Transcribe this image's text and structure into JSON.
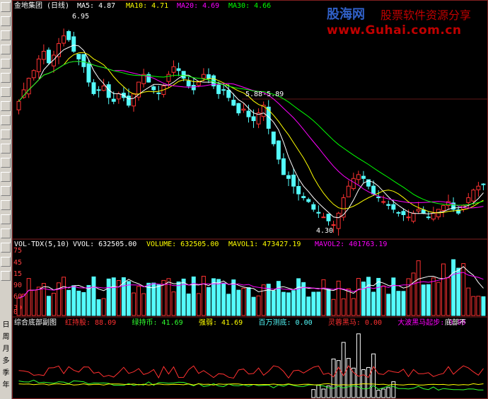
{
  "toolbar": {
    "buttons": [
      "cursor-icon",
      "line-chart-icon",
      "candle-icon",
      "ohlc-icon",
      "bar-icon",
      "fa-icon",
      "fa2-icon",
      "fa3-icon",
      "fa4-icon",
      "fz-icon",
      "tab-icon",
      "list-icon",
      "grid-icon",
      "rsi-icon",
      "dollar-icon",
      "move-icon",
      "exit-icon",
      "export-icon",
      "pen-icon",
      "fs-icon"
    ],
    "periods": [
      "日",
      "周",
      "月",
      "多",
      "季",
      "年"
    ]
  },
  "main": {
    "title": "金地集团 (日线)",
    "ma5_label": "MA5: ",
    "ma5_value": "4.87",
    "ma10_label": "MA10: ",
    "ma10_value": "4.71",
    "ma20_label": "MA20: ",
    "ma20_value": "4.69",
    "ma30_label": "MA30: ",
    "ma30_value": "4.66",
    "high_label": "6.95",
    "mid_label": "5.88-5.89",
    "low_label": "4.30",
    "colors": {
      "ma5": "#ffffff",
      "ma10": "#ffff00",
      "ma20": "#ff00ff",
      "ma30": "#00ff00",
      "up": "#ff3232",
      "down": "#54fcfc"
    }
  },
  "volume": {
    "title": "VOL-TDX(5,10)",
    "vvol_label": "VVOL: ",
    "vvol_value": "632505.00",
    "volume_label": "VOLUME: ",
    "volume_value": "632505.00",
    "mavol1_label": "MAVOL1: ",
    "mavol1_value": "473427.19",
    "mavol2_label": "MAVOL2: ",
    "mavol2_value": "401763.19",
    "axis": [
      "75",
      "45",
      "15",
      "90",
      "60",
      "30",
      "0"
    ]
  },
  "indicator": {
    "title": "综合底部副图",
    "items": [
      {
        "label": "红持股: ",
        "value": "88.09",
        "color": "#ff3030"
      },
      {
        "label": "绿持币: ",
        "value": "41.69",
        "color": "#30ff30"
      },
      {
        "label": "强弱: ",
        "value": "41.69",
        "color": "#ffff00"
      },
      {
        "label": "百万测底: ",
        "value": "0.00",
        "color": "#54fcfc"
      },
      {
        "label": "灵蓉黑马: ",
        "value": "0.00",
        "color": "#ff3030"
      },
      {
        "label": "大波黑马起步: ",
        "value": "0.00",
        "color": "#ff00ff"
      }
    ],
    "tail": "底部不"
  },
  "watermark": {
    "brand": "股海网",
    "slogan": "股票软件资源分享",
    "url": "www.Guhai.com.cn"
  },
  "chart_data": {
    "type": "candlestick",
    "title": "金地集团 (日线)",
    "close_series": [
      5.95,
      6.1,
      6.25,
      6.35,
      6.5,
      6.6,
      6.45,
      6.55,
      6.7,
      6.8,
      6.75,
      6.6,
      6.5,
      6.4,
      6.2,
      6.05,
      6.1,
      6.15,
      6.0,
      5.95,
      6.05,
      6.0,
      5.9,
      6.05,
      6.2,
      6.3,
      6.2,
      6.1,
      6.05,
      6.15,
      6.3,
      6.4,
      6.35,
      6.25,
      6.15,
      6.1,
      6.2,
      6.3,
      6.25,
      6.15,
      6.05,
      6.1,
      6.0,
      5.9,
      5.8,
      5.85,
      5.75,
      5.7,
      5.8,
      5.9,
      5.6,
      5.4,
      5.2,
      5.0,
      4.95,
      4.85,
      4.75,
      4.7,
      4.65,
      4.55,
      4.5,
      4.45,
      4.4,
      4.35,
      4.5,
      4.7,
      4.85,
      4.95,
      5.0,
      4.95,
      4.85,
      4.75,
      4.7,
      4.65,
      4.6,
      4.55,
      4.5,
      4.48,
      4.45,
      4.5,
      4.55,
      4.5,
      4.45,
      4.5,
      4.55,
      4.6,
      4.65,
      4.55,
      4.5,
      4.6,
      4.7,
      4.8,
      4.85,
      4.87
    ],
    "ylim": [
      4.2,
      7.1
    ],
    "price_labels": {
      "high": 6.95,
      "mid": "5.88-5.89",
      "low": 4.3
    },
    "volume_ylim": [
      0,
      100
    ],
    "indicator_ylim": [
      0,
      100
    ]
  }
}
